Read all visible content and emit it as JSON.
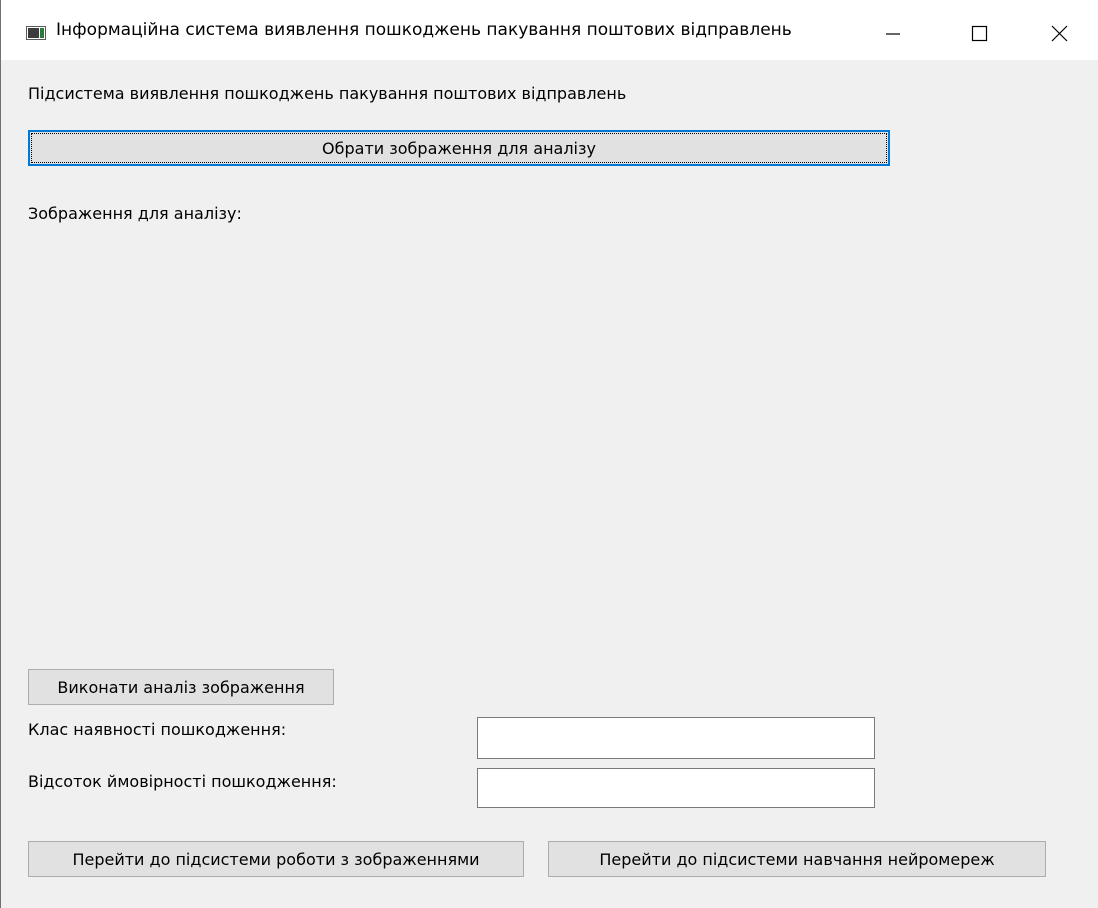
{
  "window": {
    "title": "Інформаційна система виявлення пошкоджень пакування поштових відправлень",
    "controls": {
      "minimize": "minimize-icon",
      "maximize": "maximize-icon",
      "close": "close-icon"
    }
  },
  "main": {
    "subsystem_label": "Підсистема виявлення пошкоджень пакування поштових відправлень",
    "select_image_button": "Обрати зображення для аналізу",
    "image_label": "Зображення для аналізу:",
    "analyze_button": "Виконати аналіз зображення",
    "damage_class_label": "Клас наявності пошкодження:",
    "damage_class_value": "",
    "damage_probability_label": "Відсоток ймовірності пошкодження:",
    "damage_probability_value": ""
  },
  "footer": {
    "image_subsystem_button": "Перейти до підсистеми роботи з зображеннями",
    "training_subsystem_button": "Перейти до підсистеми навчання нейромереж"
  },
  "colors": {
    "window_background": "#f0f0f0",
    "button_face": "#e1e1e1",
    "focus_border": "#0078d7"
  }
}
